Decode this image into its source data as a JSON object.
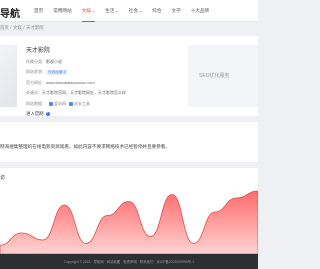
{
  "header": {
    "logo": "导航",
    "nav": [
      {
        "label": "首页",
        "active": false,
        "dropdown": false
      },
      {
        "label": "常用网站",
        "active": false,
        "dropdown": false
      },
      {
        "label": "文娱",
        "active": true,
        "dropdown": true
      },
      {
        "label": "生活",
        "active": false,
        "dropdown": true
      },
      {
        "label": "社会",
        "active": false,
        "dropdown": true
      },
      {
        "label": "综合",
        "active": false,
        "dropdown": false
      },
      {
        "label": "文学",
        "active": false,
        "dropdown": false
      },
      {
        "label": "十大品牌",
        "active": false,
        "dropdown": false
      }
    ],
    "chevron": "⌄"
  },
  "breadcrumb": {
    "sep": "/",
    "items": [
      "首页",
      "文娱",
      "天才影院"
    ]
  },
  "site": {
    "title": "天才影院",
    "region_label": "所属分类：",
    "region_value": "影视小说",
    "status_label": "网站状态：",
    "status_badge": "在线运营中",
    "url_label": "官方网址：",
    "url_value": "www.tiancaidiancaowc.com",
    "keywords_label": "关键词：",
    "keywords_value": "天才影院官网，天才影院网址，天才影院怎么样",
    "ranking_label": "网站数据：",
    "rank_items": [
      "爱站网",
      "站长工具"
    ],
    "enter_link": "进入官网"
  },
  "seo_placeholder": "SEO优化服务",
  "notice": "网海搜集整理的在线电影资源观看，如此内容不要求网络技术已经暂停并且要参看。",
  "chart": {
    "title": "访",
    "bar_color": "#f0505a"
  },
  "chart_data": {
    "type": "area",
    "title": "",
    "series": [
      {
        "values": [
          5,
          12,
          8,
          28,
          6,
          22,
          30,
          10,
          34,
          6,
          24,
          32,
          36
        ]
      }
    ],
    "ylim": [
      0,
      40
    ],
    "grid": false
  },
  "footer": {
    "text": "Copyright © 2023 · 导航网 · 网站地图 · 免责声明 · 联系我们 · 京ICP备2022009999号-1"
  }
}
